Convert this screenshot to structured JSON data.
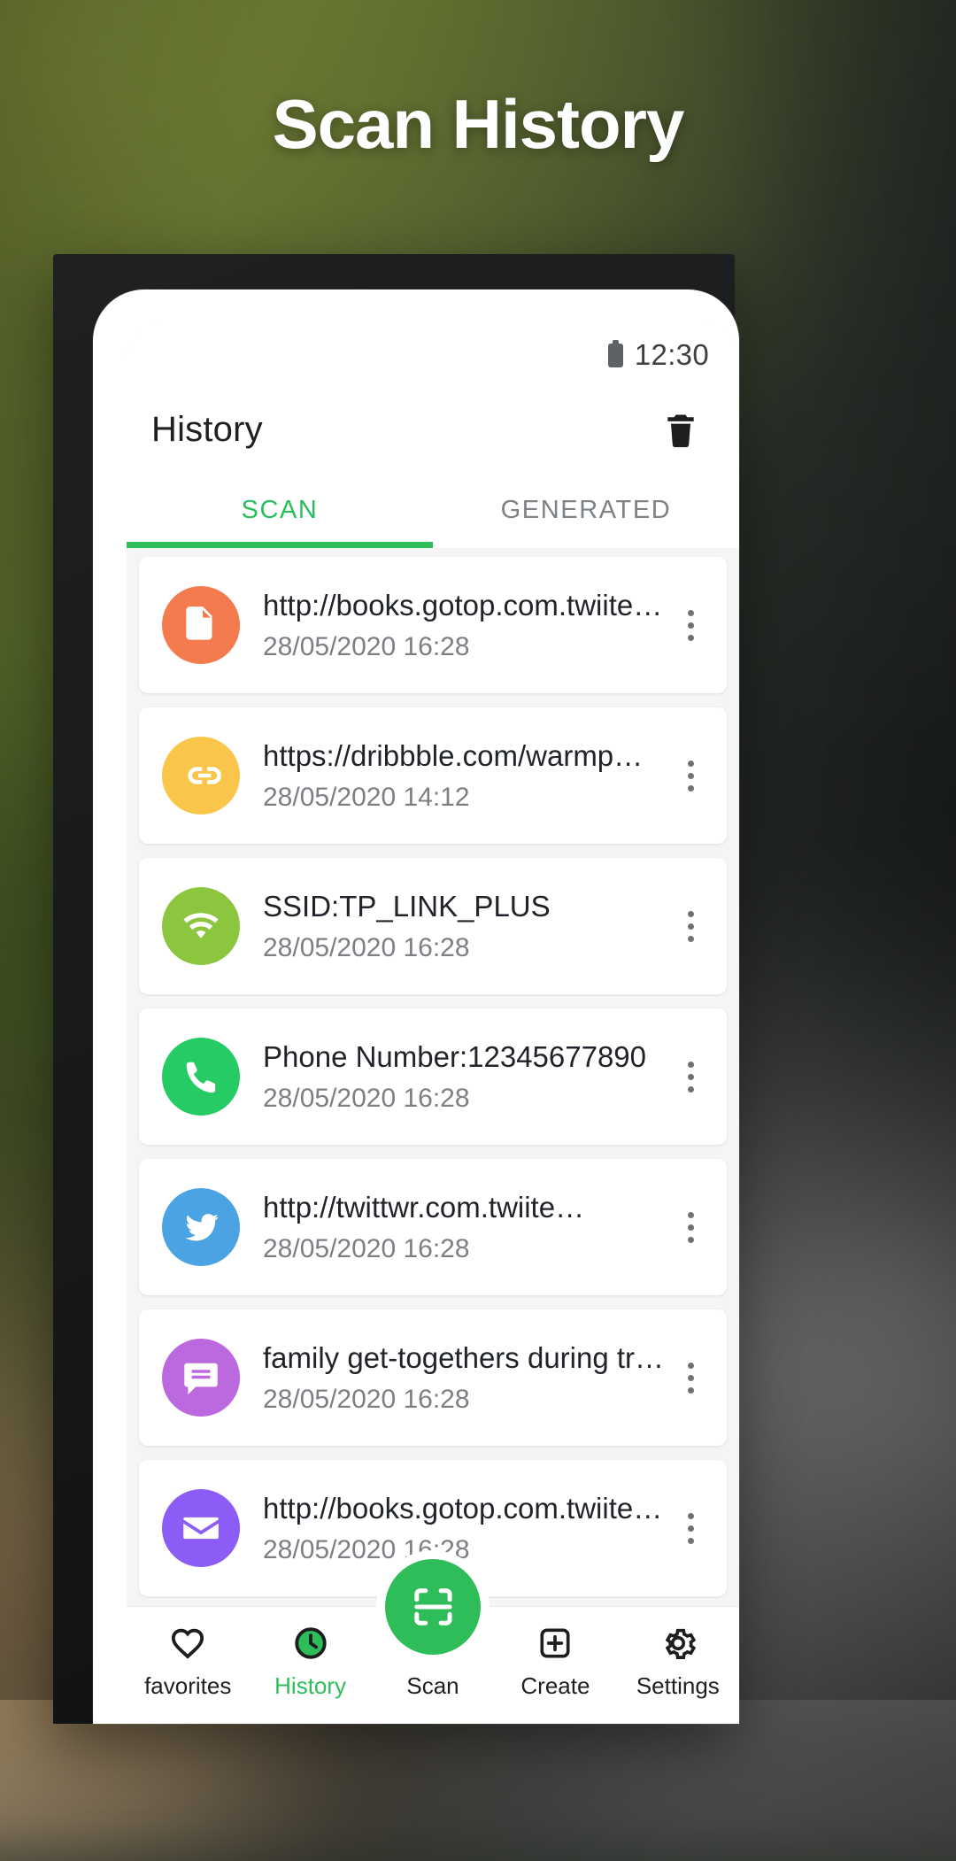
{
  "promo": {
    "headline": "Scan History"
  },
  "statusbar": {
    "battery_icon": "battery-icon",
    "time": "12:30"
  },
  "appbar": {
    "title": "History",
    "delete_icon": "trash-icon"
  },
  "tabs": [
    {
      "label": "SCAN",
      "active": true
    },
    {
      "label": "GENERATED",
      "active": false
    }
  ],
  "list": {
    "items": [
      {
        "icon": "document-icon",
        "color": "#F47B4D",
        "title": "http://books.gotop.com.twiite…",
        "timestamp": "28/05/2020 16:28",
        "menu_icon": "kebab-menu-icon"
      },
      {
        "icon": "link-icon",
        "color": "#FAC council",
        "title": "https://dribbble.com/warmp…",
        "timestamp": "28/05/2020 14:12",
        "menu_icon": "kebab-menu-icon"
      },
      {
        "icon": "wifi-icon",
        "color": "#8CC63F",
        "title": "SSID:TP_LINK_PLUS",
        "timestamp": "28/05/2020 16:28",
        "menu_icon": "kebab-menu-icon"
      },
      {
        "icon": "phone-icon",
        "color": "#27CB63",
        "title": "Phone Number:12345677890",
        "timestamp": "28/05/2020 16:28",
        "menu_icon": "kebab-menu-icon"
      },
      {
        "icon": "twitter-icon",
        "color": "#4BA3E3",
        "title": "http://twittwr.com.twiite…",
        "timestamp": "28/05/2020 16:28",
        "menu_icon": "kebab-menu-icon"
      },
      {
        "icon": "message-icon",
        "color": "#BC68DE",
        "title": "family get-togethers during tr…",
        "timestamp": "28/05/2020 16:28",
        "menu_icon": "kebab-menu-icon"
      },
      {
        "icon": "email-icon",
        "color": "#8B5CF6",
        "title": "http://books.gotop.com.twiite…",
        "timestamp": "28/05/2020 16:28",
        "menu_icon": "kebab-menu-icon"
      }
    ]
  },
  "bottomnav": {
    "items": [
      {
        "label": "favorites",
        "icon": "heart-icon",
        "active": false
      },
      {
        "label": "History",
        "icon": "clock-icon",
        "active": true
      },
      {
        "label": "Scan",
        "icon": "scan-frame-icon",
        "active": false
      },
      {
        "label": "Create",
        "icon": "plus-box-icon",
        "active": false
      },
      {
        "label": "Settings",
        "icon": "gear-icon",
        "active": false
      }
    ]
  },
  "colors": {
    "accent_green": "#2EBD58",
    "tab_active": "#27C05C",
    "screen_bg": "#F5F5F5"
  }
}
